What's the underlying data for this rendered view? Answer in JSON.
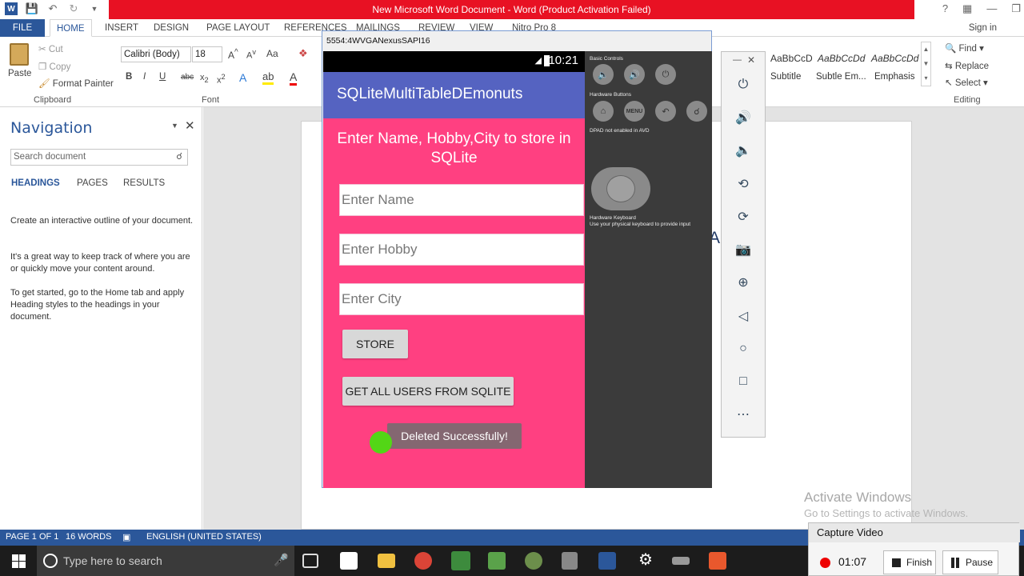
{
  "word": {
    "title": "New Microsoft Word Document - Word (Product Activation Failed)",
    "tabs": [
      "FILE",
      "HOME",
      "INSERT",
      "DESIGN",
      "PAGE LAYOUT",
      "REFERENCES",
      "MAILINGS",
      "REVIEW",
      "VIEW",
      "Nitro Pro 8"
    ],
    "sign_in": "Sign in",
    "clipboard": {
      "paste": "Paste",
      "cut": "Cut",
      "copy": "Copy",
      "format_painter": "Format Painter",
      "group": "Clipboard"
    },
    "font": {
      "family": "Calibri (Body)",
      "size": "18",
      "group": "Font"
    },
    "styles": [
      {
        "sample": "AaBbCcD",
        "name": "Subtitle"
      },
      {
        "sample": "AaBbCcDd",
        "name": "Subtle Em..."
      },
      {
        "sample": "AaBbCcDd",
        "name": "Emphasis"
      }
    ],
    "editing": {
      "find": "Find",
      "replace": "Replace",
      "select": "Select",
      "group": "Editing"
    },
    "navigation": {
      "title": "Navigation",
      "search_placeholder": "Search document",
      "tabs": [
        "HEADINGS",
        "PAGES",
        "RESULTS"
      ],
      "p1": "Create an interactive outline of your document.",
      "p2": "It's a great way to keep track of where you are or quickly move your content around.",
      "p3": "To get started, go to the Home tab and apply Heading styles to the headings in your document."
    },
    "doc_text": "A   FOR",
    "watermark": {
      "line1": "Activate Windows",
      "line2": "Go to Settings to activate Windows."
    },
    "status": {
      "page": "PAGE 1 OF 1",
      "words": "16 WORDS",
      "language": "ENGLISH (UNITED STATES)"
    }
  },
  "emulator": {
    "title": "5554:4WVGANexusSAPI16",
    "clock": "10:21",
    "app_title": "SQLiteMultiTableDEmonuts",
    "heading": "Enter Name, Hobby,City to store in SQLite",
    "name_placeholder": "Enter Name",
    "hobby_placeholder": "Enter Hobby",
    "city_placeholder": "Enter City",
    "store_button": "STORE",
    "get_all_button": "GET ALL USERS FROM SQLITE",
    "toast": "Deleted Successfully!",
    "controls": {
      "basic": "Basic Controls",
      "hardware": "Hardware Buttons",
      "menu": "MENU",
      "dpad": "DPAD not enabled in AVD",
      "keyboard_title": "Hardware Keyboard",
      "keyboard_desc": "Use your physical keyboard to provide input"
    }
  },
  "taskbar": {
    "search_placeholder": "Type here to search"
  },
  "capture": {
    "title": "Capture Video",
    "time": "01:07",
    "finish": "Finish",
    "pause": "Pause"
  }
}
